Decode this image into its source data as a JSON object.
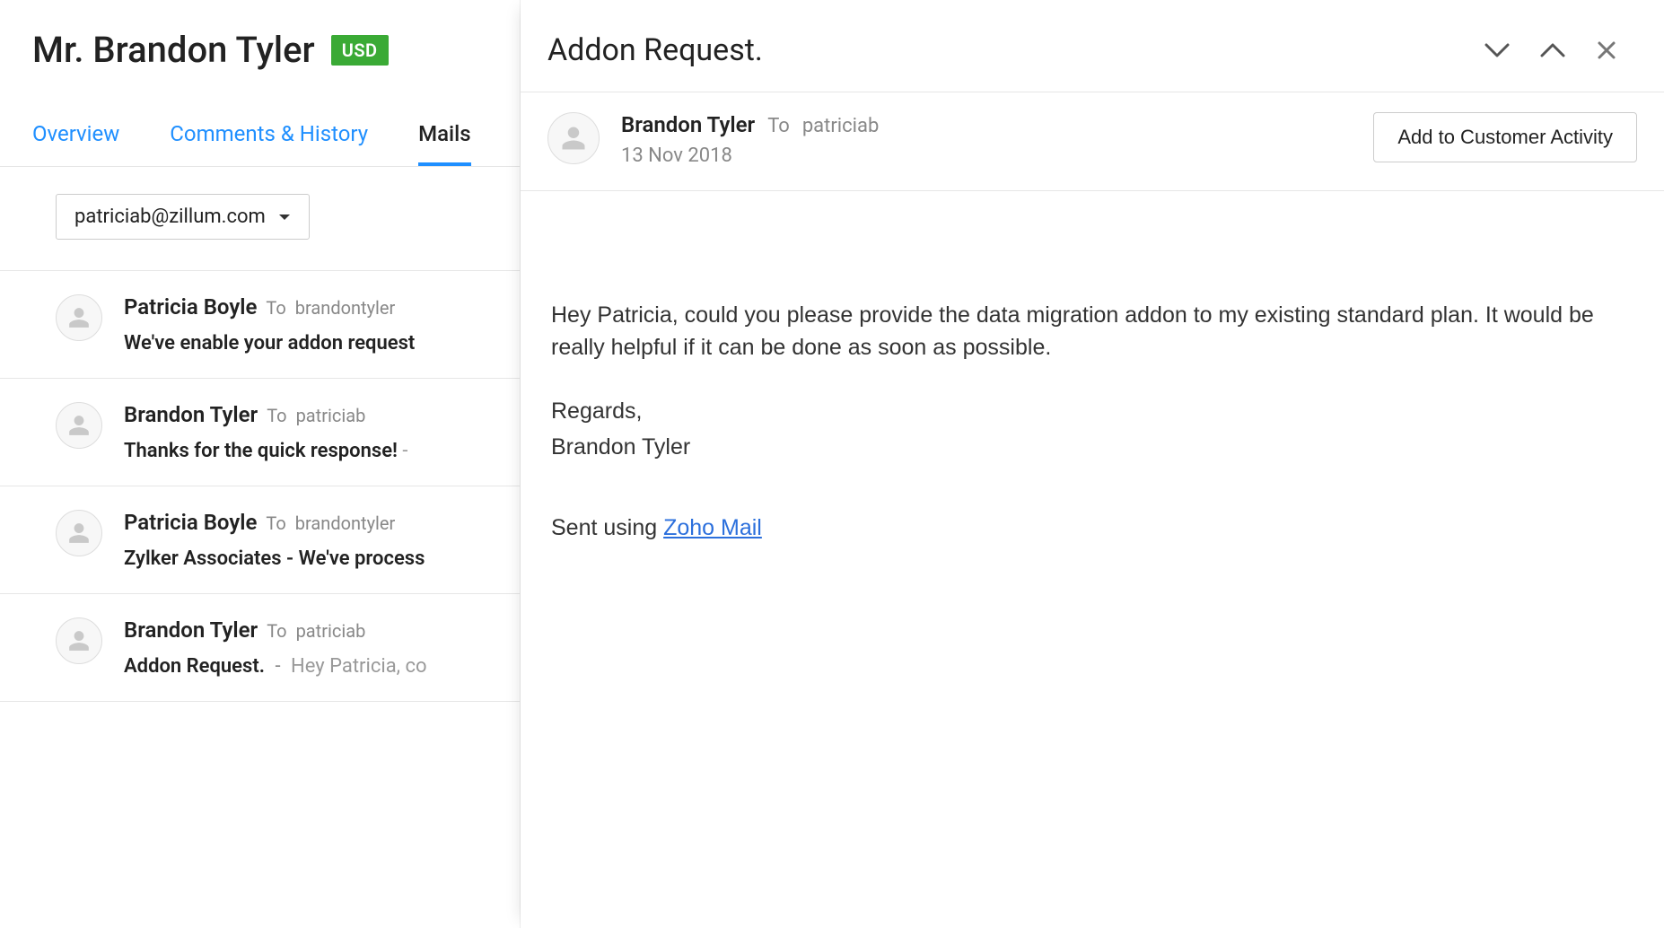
{
  "customer": {
    "name": "Mr. Brandon Tyler",
    "currency_badge": "USD"
  },
  "tabs": {
    "overview": "Overview",
    "comments": "Comments & History",
    "mails": "Mails"
  },
  "filter": {
    "selected_email": "patriciab@zillum.com"
  },
  "mails": [
    {
      "from": "Patricia Boyle",
      "to_label": "To",
      "to": "brandontyler",
      "subject": "We've enable your addon request"
    },
    {
      "from": "Brandon Tyler",
      "to_label": "To",
      "to": "patriciab",
      "subject": "Thanks for the quick response!",
      "preview_sep": "  -"
    },
    {
      "from": "Patricia Boyle",
      "to_label": "To",
      "to": "brandontyler",
      "subject": "Zylker Associates - We've process"
    },
    {
      "from": "Brandon Tyler",
      "to_label": "To",
      "to": "patriciab",
      "subject": "Addon Request.",
      "preview_sep": "-",
      "preview": "Hey Patricia, co"
    }
  ],
  "detail": {
    "title": "Addon Request.",
    "from": "Brandon Tyler",
    "to_label": "To",
    "to": "patriciab",
    "date": "13 Nov 2018",
    "activity_button": "Add to Customer Activity",
    "body_para": "Hey Patricia, could you please provide the data migration addon to my existing standard plan. It would be really helpful if it can be done as soon as possible.",
    "regards": "Regards,",
    "signature": "Brandon Tyler",
    "sent_using_label": "Sent using ",
    "sent_using_link": "Zoho Mail"
  }
}
